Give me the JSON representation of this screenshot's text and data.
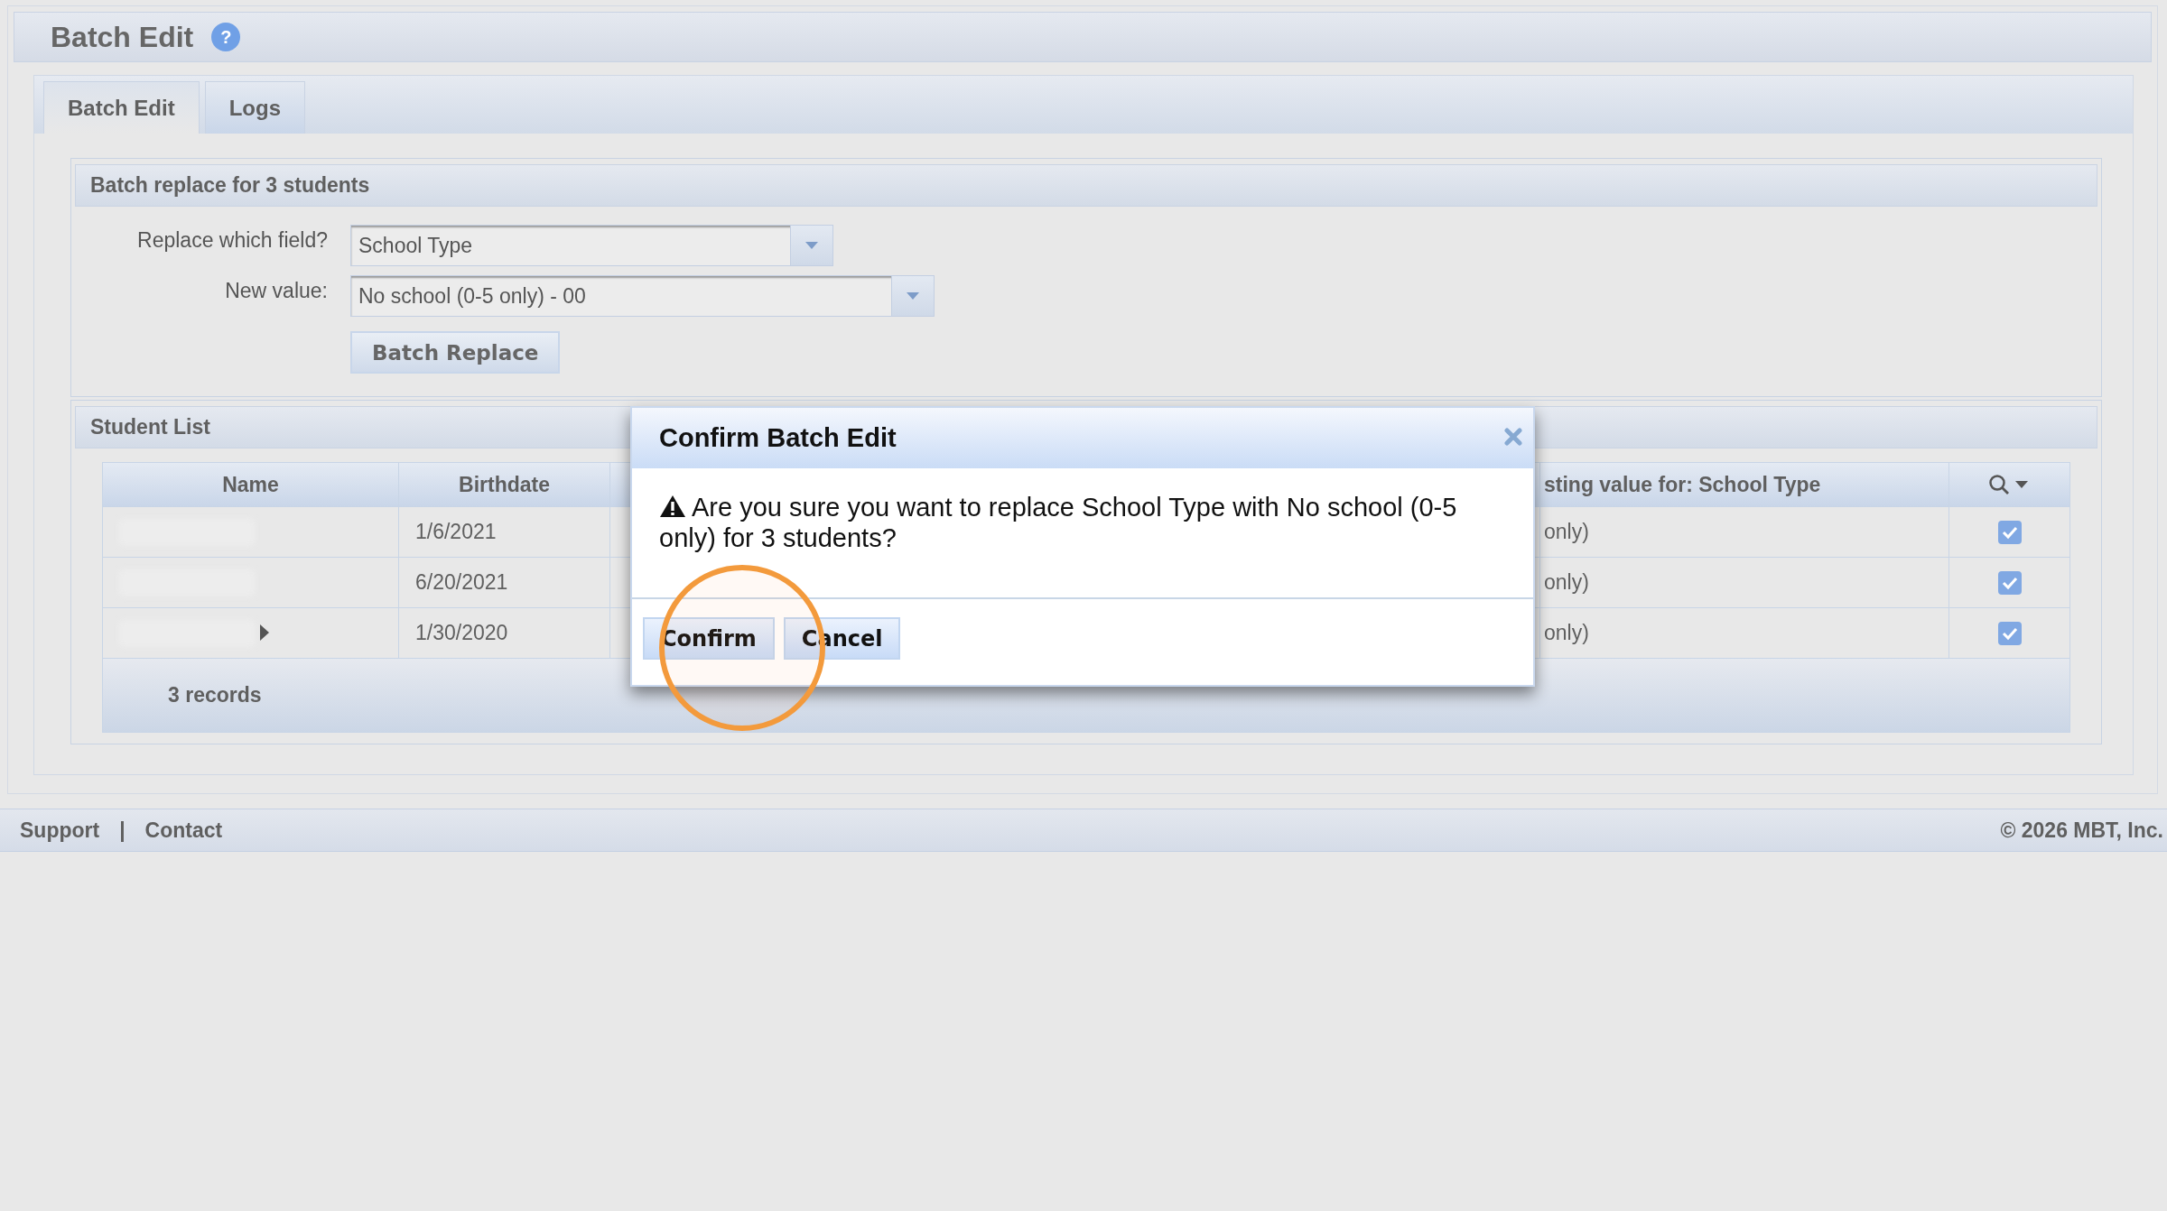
{
  "page": {
    "title": "Batch Edit",
    "help": "?"
  },
  "tabs": [
    {
      "label": "Batch Edit",
      "selected": true
    },
    {
      "label": "Logs",
      "selected": false
    }
  ],
  "batch_replace": {
    "title": "Batch replace for 3 students",
    "fields": [
      {
        "label": "Replace which field?",
        "value": "School Type"
      },
      {
        "label": "New value:",
        "value": "No school (0-5 only) - 00"
      }
    ],
    "button": "Batch Replace"
  },
  "student_list": {
    "title": "Student List",
    "columns": {
      "name": "Name",
      "birthdate": "Birthdate",
      "column_4": "sting value for: School Type"
    },
    "rows": [
      {
        "birthdate": "1/6/2021",
        "column_4": "only)",
        "expandable": false,
        "checked": true
      },
      {
        "birthdate": "6/20/2021",
        "column_4": "only)",
        "expandable": false,
        "checked": true
      },
      {
        "birthdate": "1/30/2020",
        "column_4": "only)",
        "expandable": true,
        "checked": true
      }
    ],
    "footer": "3 records"
  },
  "dialog": {
    "title": "Confirm Batch Edit",
    "message": "Are you sure you want to replace School Type with No school (0-5 only) for 3 students?",
    "buttons": [
      "Confirm",
      "Cancel"
    ]
  },
  "footer": {
    "links": [
      "Support",
      "Contact"
    ],
    "separator": "|",
    "copyright": "© 2026 MBT, Inc."
  }
}
